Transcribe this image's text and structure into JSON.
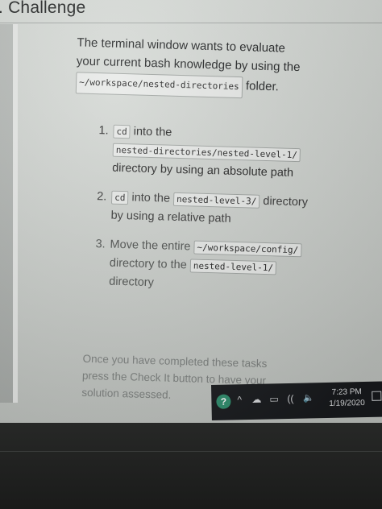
{
  "heading": ". Challenge",
  "intro": {
    "line1": "The terminal window wants to evaluate your current bash knowledge by using the",
    "folder_code": "~/workspace/nested-directories",
    "folder_suffix": "folder."
  },
  "tasks": [
    {
      "number": "1.",
      "code1": "cd",
      "text1": "into the",
      "code2": "nested-directories/nested-level-1/",
      "text2": "directory by using an absolute path"
    },
    {
      "number": "2.",
      "code1": "cd",
      "text1": "into the",
      "code2": "nested-level-3/",
      "text2": "directory by using a relative path"
    },
    {
      "number": "3.",
      "text1": "Move the entire",
      "code1": "~/workspace/config/",
      "text2": "directory to the",
      "code2": "nested-level-1/",
      "text3": "directory"
    }
  ],
  "note": "Once you have completed these tasks press the Check It button to have your solution assessed.",
  "taskbar": {
    "help_icon": "?",
    "chevron_icon": "^",
    "cloud_icon": "☁",
    "battery_icon": "▭",
    "wifi_icon": "((",
    "volume_icon": "🔈",
    "time": "7:23 PM",
    "date": "1/19/2020"
  },
  "colors": {
    "screen_bg": "#d7dbd7",
    "text": "#1e2021",
    "note_text": "#7c807e",
    "code_bg": "#e7e9e7",
    "taskbar_bg": "#181a1d",
    "help_icon_bg": "#2f8f6e"
  }
}
